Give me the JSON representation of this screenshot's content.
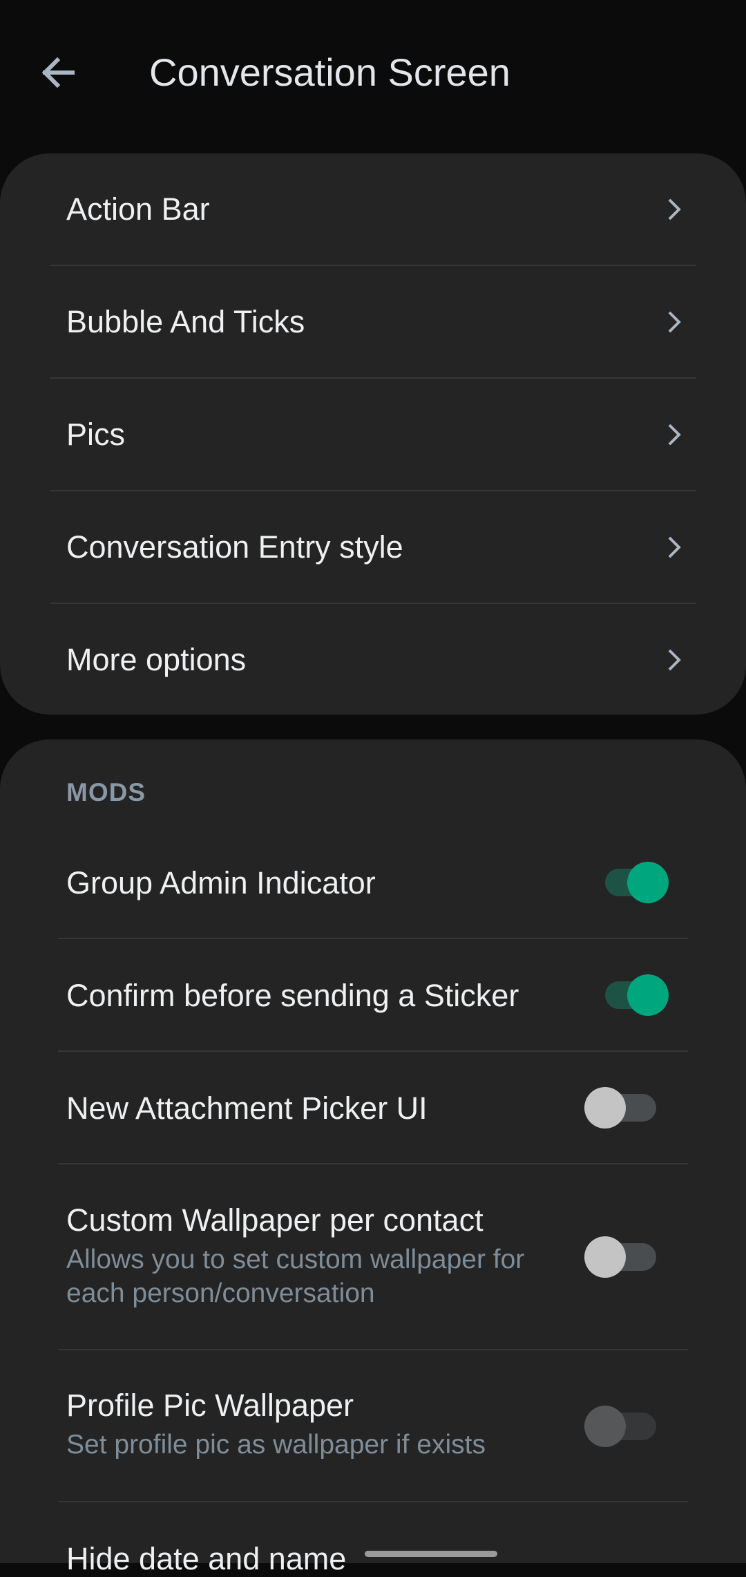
{
  "header": {
    "title": "Conversation Screen",
    "back_icon": "arrow-left-icon"
  },
  "menu": [
    {
      "label": "Action Bar"
    },
    {
      "label": "Bubble And Ticks"
    },
    {
      "label": "Pics"
    },
    {
      "label": "Conversation Entry style"
    },
    {
      "label": "More options"
    }
  ],
  "mods": {
    "section_title": "MODS",
    "items": [
      {
        "label": "Group Admin Indicator",
        "subtitle": "",
        "state": "on"
      },
      {
        "label": "Confirm before sending a Sticker",
        "subtitle": "",
        "state": "on"
      },
      {
        "label": "New Attachment Picker UI",
        "subtitle": "",
        "state": "off"
      },
      {
        "label": "Custom Wallpaper per contact",
        "subtitle": "Allows you to set custom wallpaper for each person/conversation",
        "state": "off"
      },
      {
        "label": "Profile Pic Wallpaper",
        "subtitle": "Set profile pic as wallpaper if exists",
        "state": "disabled"
      },
      {
        "label": "Hide date and name",
        "subtitle": "",
        "state": ""
      }
    ]
  },
  "colors": {
    "background": "#0b0b0b",
    "card": "#242424",
    "accent": "#00a67e",
    "accent_track": "#1e5244",
    "section": "#8a98a6",
    "subtitle": "#7f8d99"
  }
}
